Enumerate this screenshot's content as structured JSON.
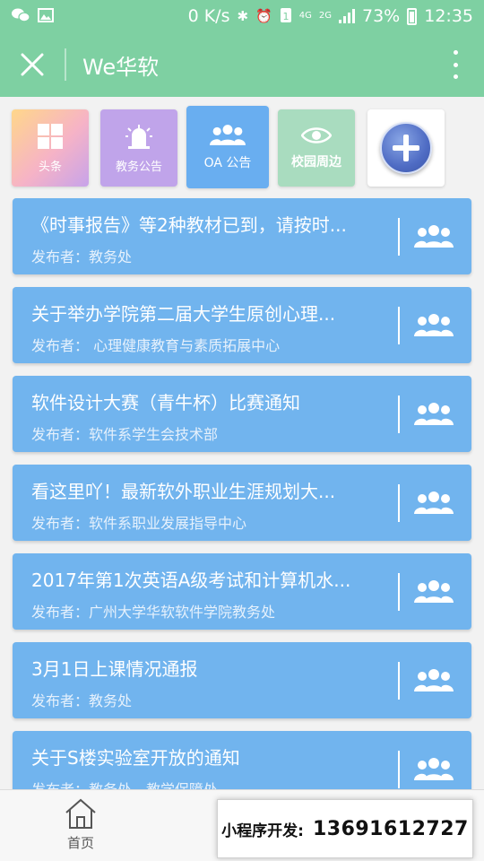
{
  "status_bar": {
    "speed": "0 K/s",
    "network_4g": "4G",
    "network_2g": "2G",
    "battery": "73%",
    "time": "12:35"
  },
  "header": {
    "title": "We华软"
  },
  "tiles": [
    {
      "label": "头条",
      "icon": "grid-icon"
    },
    {
      "label": "教务公告",
      "icon": "siren-icon"
    },
    {
      "label": "OA 公告",
      "icon": "group-icon"
    },
    {
      "label": "校园周边",
      "icon": "eye-icon"
    },
    {
      "label": "",
      "icon": "plus-icon"
    }
  ],
  "posts": [
    {
      "title": "《时事报告》等2种教材已到，请按时...",
      "publisher": "发布者：教务处"
    },
    {
      "title": "关于举办学院第二届大学生原创心理...",
      "publisher": "发布者： 心理健康教育与素质拓展中心"
    },
    {
      "title": "软件设计大赛（青牛杯）比赛通知",
      "publisher": "发布者：软件系学生会技术部"
    },
    {
      "title": "看这里吖！最新软外职业生涯规划大...",
      "publisher": "发布者：软件系职业发展指导中心"
    },
    {
      "title": "2017年第1次英语A级考试和计算机水...",
      "publisher": "发布者：广州大学华软软件学院教务处"
    },
    {
      "title": "3月1日上课情况通报",
      "publisher": "发布者：教务处"
    },
    {
      "title": "关于S楼实验室开放的通知",
      "publisher": "发布者：教务处、教学保障处"
    }
  ],
  "tab_bar": {
    "home_label": "首页"
  },
  "promo": {
    "label": "小程序开发:",
    "phone": "13691612727"
  },
  "colors": {
    "brand_green": "#7ed0a2",
    "card_blue": "#71b4ee"
  }
}
